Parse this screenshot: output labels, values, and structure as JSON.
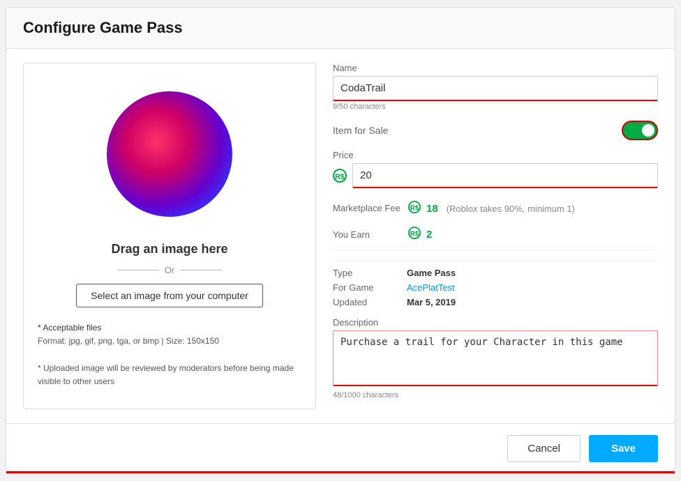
{
  "modal": {
    "title": "Configure Game Pass"
  },
  "left": {
    "drag_text": "Drag an image here",
    "or_text": "Or",
    "select_btn": "Select an image from your computer",
    "file_info_1": "* Acceptable files",
    "file_info_2": "Format: jpg, gif, png, tga, or bmp | Size: 150x150",
    "file_info_3": "* Uploaded image will be reviewed by moderators before being made visible to other users"
  },
  "right": {
    "name_label": "Name",
    "name_value": "CodaTrail",
    "name_chars": "9/50 characters",
    "item_for_sale_label": "Item for Sale",
    "price_label": "Price",
    "price_value": "20",
    "marketplace_label": "Marketplace Fee",
    "marketplace_value": "18",
    "marketplace_note": "(Roblox takes 90%, minimum 1)",
    "you_earn_label": "You Earn",
    "you_earn_value": "2",
    "type_label": "Type",
    "type_value": "Game Pass",
    "for_game_label": "For Game",
    "for_game_value": "AcePlatTest",
    "updated_label": "Updated",
    "updated_value": "Mar 5, 2019",
    "description_label": "Description",
    "description_value": "Purchase a trail for your Character in this game",
    "description_chars": "48/1000 characters"
  },
  "footer": {
    "cancel_label": "Cancel",
    "save_label": "Save"
  },
  "icons": {
    "robux": "®"
  }
}
